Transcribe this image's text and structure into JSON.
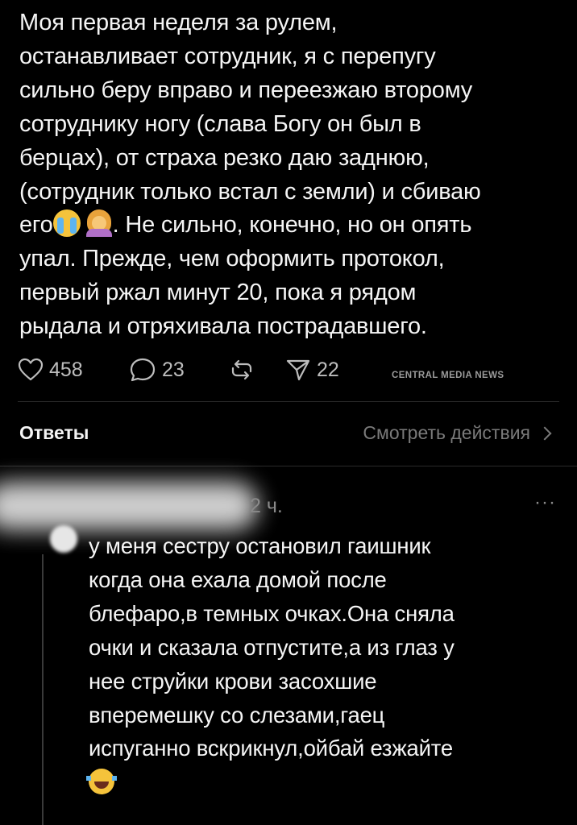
{
  "post": {
    "text_part1": "Моя первая неделя за рулем,\nостанавливает сотрудник, я с перепугу\nсильно беру вправо и переезжаю второму\nсотруднику ногу (слава Богу он был в\nберцах), от страха резко даю заднюю,\n(сотрудник только встал с земли) и сбиваю\nего",
    "emoji_1": "loudly-crying-face-emoji",
    "emoji_2": "woman-facepalming-emoji",
    "text_part2": ". Не сильно, конечно, но он опять\nупал. Прежде, чем оформить протокол,\nпервый ржал минут 20, пока я рядом\nрыдала и отряхивала пострадавшего."
  },
  "actions": {
    "likes": "458",
    "replies": "23",
    "reposts": "",
    "shares": "22"
  },
  "watermark": "CENTRAL MEDIA NEWS",
  "answers": {
    "title": "Ответы",
    "view_actions": "Смотреть действия"
  },
  "reply": {
    "time": "2 ч.",
    "more": "···",
    "text": "у меня сестру остановил гаишник\nкогда она ехала домой после\nблефаро,в темных очках.Она сняла\nочки и сказала отпустите,а из глаз у\nнее струйки крови засохшие\nвперемешку со слезами,гаец\nиспуганно вскрикнул,ойбай езжайте",
    "emoji": "face-with-tears-of-joy-emoji"
  },
  "colors": {
    "background": "#000000",
    "text": "#f5f5f5",
    "secondary": "#8a8a8a"
  }
}
